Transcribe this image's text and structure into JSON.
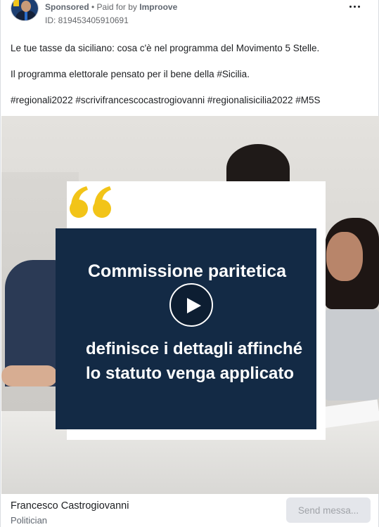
{
  "header": {
    "sponsored_label": "Sponsored",
    "paid_for_prefix": " • Paid for by ",
    "paid_for_name": "Improove",
    "ad_id": "ID: 819453405910691"
  },
  "post": {
    "line1": "Le tue tasse da siciliano: cosa c'è nel programma del Movimento 5 Stelle.",
    "line2": "Il programma elettorale pensato per il bene della #Sicilia.",
    "hashtags": "#regionali2022 #scrivifrancescocastrogiovanni #regionalisicilia2022 #M5S"
  },
  "media": {
    "title": "Commissione paritetica",
    "subtitle": "definisce i dettagli affinché lo statuto venga applicato",
    "accent_yellow": "#f2c418",
    "navy": "#132a45"
  },
  "footer": {
    "page_name": "Francesco Castrogiovanni",
    "page_category": "Politician",
    "send_button": "Send messa..."
  },
  "icons": {
    "more": "more-options-icon",
    "play": "play-icon",
    "quote": "quote-icon"
  }
}
